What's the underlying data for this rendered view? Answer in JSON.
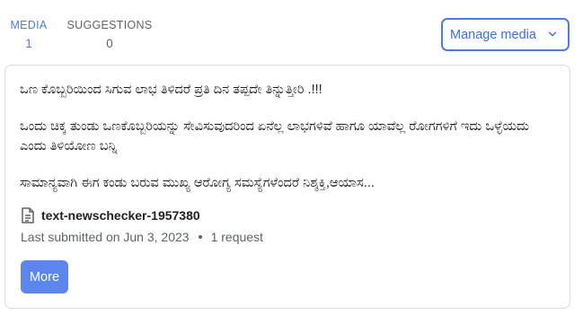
{
  "tabs": [
    {
      "label": "MEDIA",
      "count": "1"
    },
    {
      "label": "SUGGESTIONS",
      "count": "0"
    }
  ],
  "manage_media": {
    "label": "Manage media",
    "icon": "chevron-down-icon"
  },
  "card": {
    "paragraphs": [
      "ಒಣ ಕೊಬ್ಬರಿಯಿಂದ ಸಿಗುವ ಲಾಭ ತಿಳಿದರೆ ಪ್ರತಿ ದಿನ ತಪ್ಪದೇ ತಿನ್ನುತ್ತೀರಿ .!!!",
      "ಒಂದು ಚಿಕ್ಕ ತುಂಡು ಒಣಕೊಬ್ಬರಿಯನ್ನು ಸೇವಿಸುವುದರಿಂದ ಏನೆಲ್ಲ ಲಾಭಗಳಿವೆ ಹಾಗೂ ಯಾವೆಲ್ಲ ರೋಗಗಳಿಗೆ ಇದು ಒಳ್ಳೆಯದು ಎಂದು ತಿಳಿಯೋಣ ಬನ್ನಿ",
      "ಸಾಮಾನ್ಯವಾಗಿ ಈಗ ಕಂಡು ಬರುವ ಮುಖ್ಯ ಆರೋಗ್ಯ ಸಮಸ್ಯೆಗಳೆಂದರೆ ನಿಶ್ಶಕ್ತಿ,ಆಯಾಸ..."
    ],
    "file_icon": "document-icon",
    "file_name": "text-newschecker-1957380",
    "last_submitted": "Last submitted on Jun 3, 2023",
    "requests": "1 request",
    "more_label": "More"
  },
  "colors": {
    "accent": "#4a7ce8",
    "more_button": "#5c86ec"
  }
}
